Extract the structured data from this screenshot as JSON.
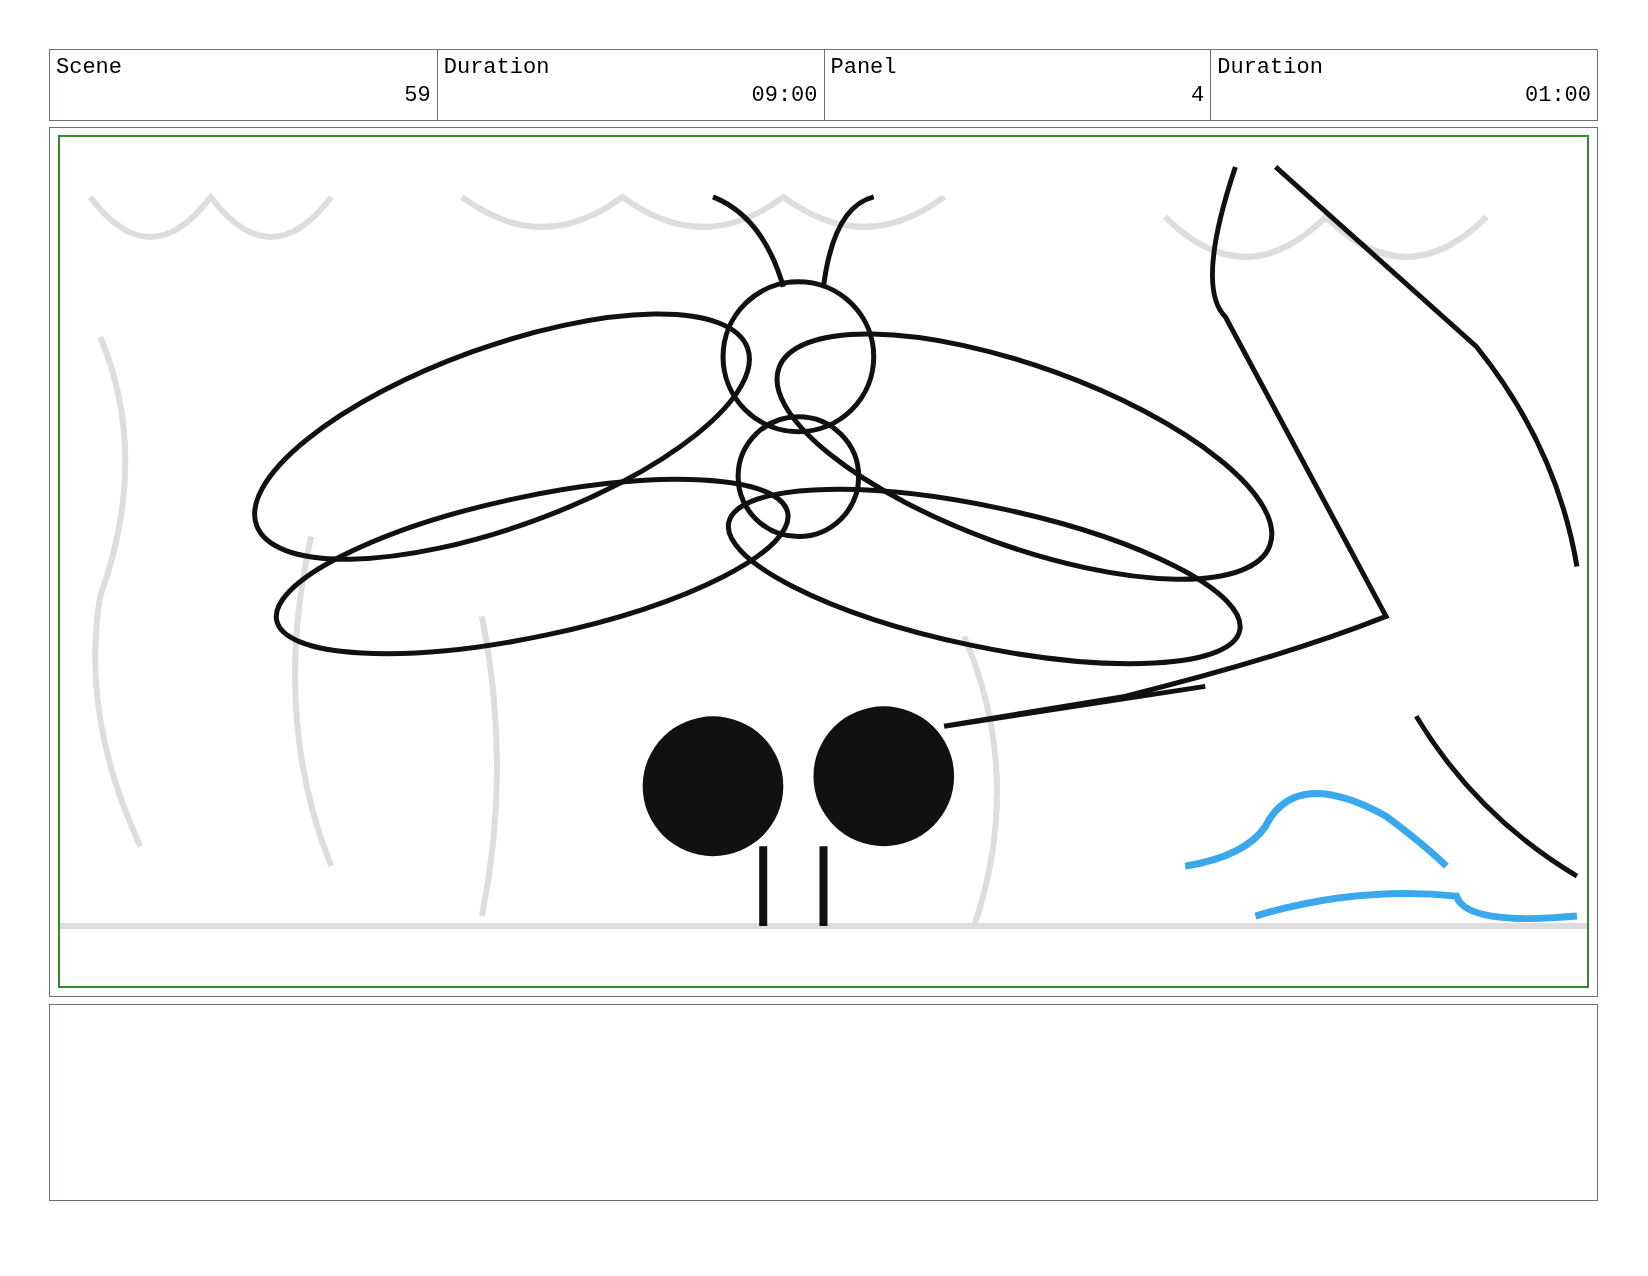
{
  "header": {
    "labels": [
      "Scene",
      "Duration",
      "Panel",
      "Duration"
    ],
    "values": [
      "59",
      "09:00",
      "4",
      "01:00"
    ]
  }
}
